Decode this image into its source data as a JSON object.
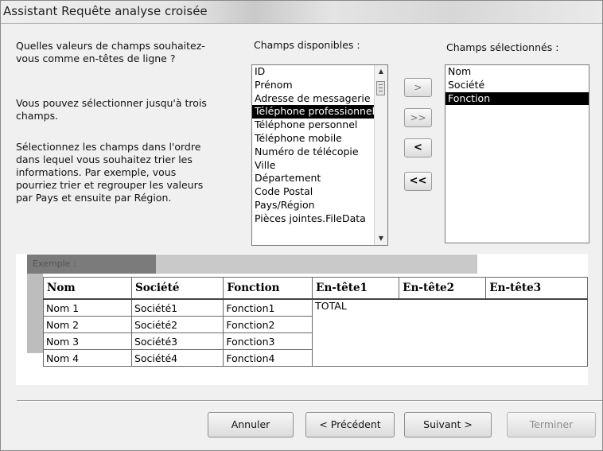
{
  "window": {
    "title": "Assistant Requête analyse croisée"
  },
  "instructions": {
    "line1": "Quelles valeurs de champs souhaitez-",
    "line2": "vous comme en-têtes de ligne ?",
    "line3": "Vous pouvez sélectionner jusqu'à trois",
    "line4": "champs.",
    "line5": "Sélectionnez les champs dans l'ordre",
    "line6": "dans lequel vous souhaitez trier les",
    "line7": "informations.  Par exemple, vous",
    "line8": "pourriez trier et regrouper les valeurs",
    "line9": "par Pays et ensuite par Région."
  },
  "available": {
    "label": "Champs disponibles :",
    "items": [
      "ID",
      "Prénom",
      "Adresse de messagerie",
      "Téléphone professionnel",
      "Téléphone personnel",
      "Téléphone mobile",
      "Numéro de télécopie",
      "Ville",
      "Département",
      "Code Postal",
      "Pays/Région",
      "Pièces jointes.FileData"
    ],
    "selected_index": 3
  },
  "selected": {
    "label": "Champs sélectionnés :",
    "items": [
      "Nom",
      "Société",
      "Fonction"
    ],
    "selected_index": 2
  },
  "move_buttons": {
    "add_one": ">",
    "add_all": ">>",
    "remove_one": "<",
    "remove_all": "<<"
  },
  "example": {
    "label": "Exemple :",
    "headers": [
      "Nom",
      "Société",
      "Fonction",
      "En-tête1",
      "En-tête2",
      "En-tête3"
    ],
    "rows": [
      [
        "Nom 1",
        "Société1",
        "Fonction1"
      ],
      [
        "Nom 2",
        "Société2",
        "Fonction2"
      ],
      [
        "Nom 3",
        "Société3",
        "Fonction3"
      ],
      [
        "Nom 4",
        "Société4",
        "Fonction4"
      ]
    ],
    "total": "TOTAL"
  },
  "footer": {
    "cancel": "Annuler",
    "previous": "< Précédent",
    "next": "Suivant >",
    "finish": "Terminer"
  }
}
